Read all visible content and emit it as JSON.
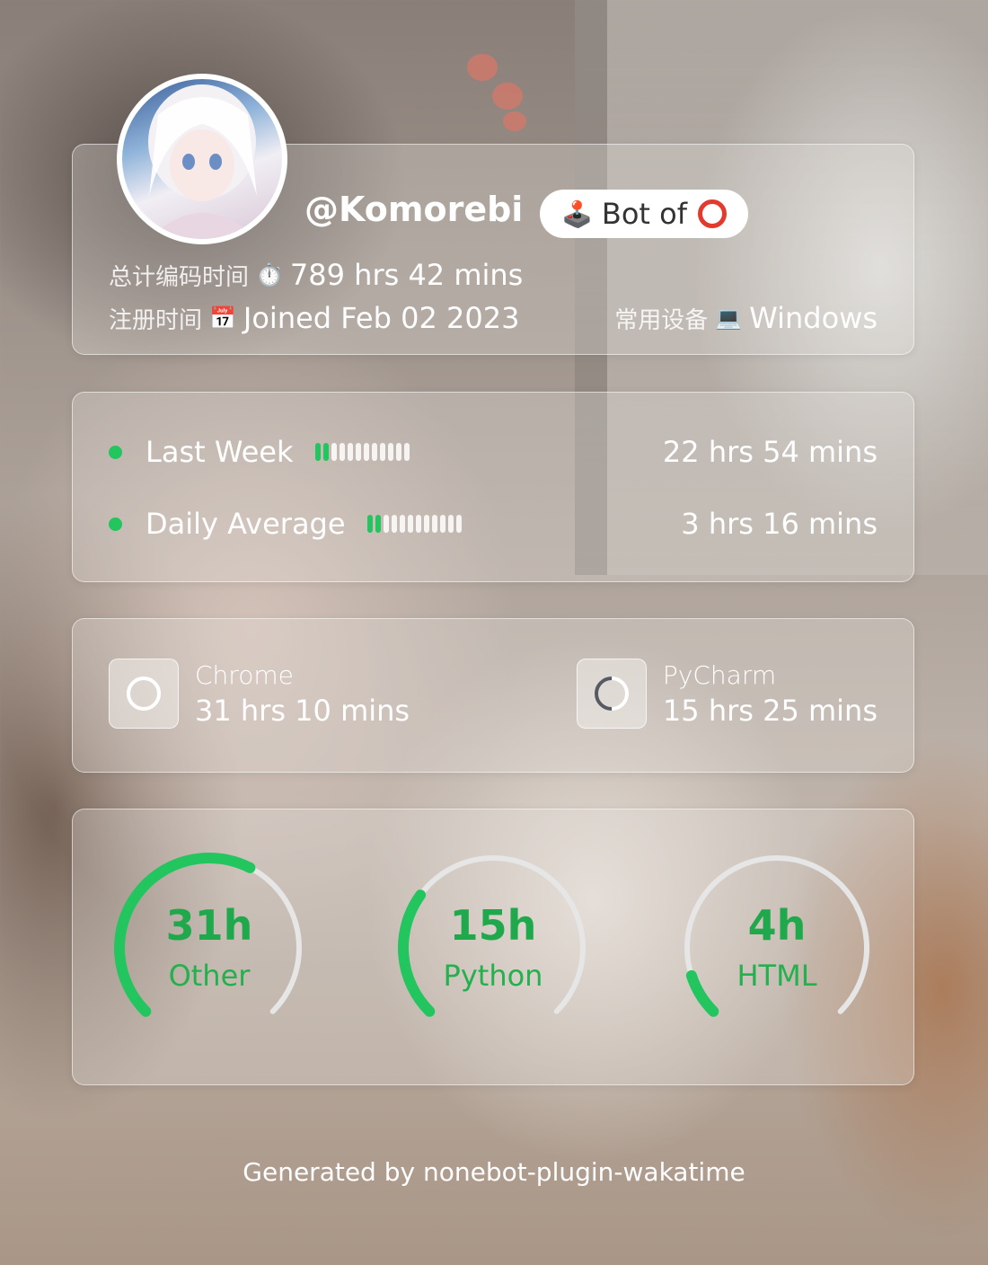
{
  "profile": {
    "username": "@Komorebi",
    "bot_badge": "Bot of",
    "total_label": "总计编码时间",
    "total_value": "789 hrs 42 mins",
    "joined_label": "注册时间",
    "joined_value": "Joined Feb 02 2023",
    "device_label": "常用设备",
    "device_value": "Windows",
    "calendar_icon_text": "July 17"
  },
  "weekly": {
    "rows": [
      {
        "label": "Last Week",
        "value": "22 hrs 54 mins",
        "bar_filled": 2,
        "bar_total": 12
      },
      {
        "label": "Daily Average",
        "value": "3 hrs 16 mins",
        "bar_filled": 2,
        "bar_total": 12
      }
    ]
  },
  "editors": [
    {
      "name": "Chrome",
      "time": "31 hrs 10 mins",
      "fraction": 1.0
    },
    {
      "name": "PyCharm",
      "time": "15 hrs 25 mins",
      "fraction": 0.5
    }
  ],
  "languages": [
    {
      "value": "31h",
      "name": "Other",
      "fraction": 0.6
    },
    {
      "value": "15h",
      "name": "Python",
      "fraction": 0.3
    },
    {
      "value": "4h",
      "name": "HTML",
      "fraction": 0.1
    }
  ],
  "colors": {
    "accent": "#22c55e",
    "gauge_track": "#e6e6e6",
    "gauge_text": "#1fa84c"
  },
  "footer": "Generated by nonebot-plugin-wakatime"
}
